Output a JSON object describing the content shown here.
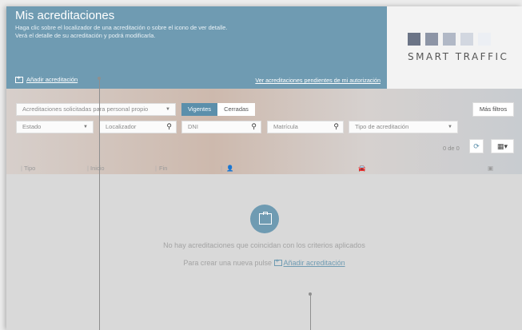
{
  "header": {
    "title": "Mis acreditaciones",
    "subtitle_line1": "Haga clic sobre el localizador de una acreditación o sobre el icono de ver detalle.",
    "subtitle_line2": "Verá el detalle de su acreditación y podrá modificarla.",
    "add_link": "Añadir acreditación",
    "pending_link": "Ver acreditaciones pendientes de mi autorización"
  },
  "logo": {
    "text": "SMART TRAFFIC",
    "square_colors": [
      "#6b7486",
      "#8d95a6",
      "#b1b8c6",
      "#d2d7e0",
      "#eceff4"
    ]
  },
  "filters": {
    "scope_select": "Acreditaciones solicitadas para personal propio",
    "segment": {
      "active": "Vigentes",
      "inactive": "Cerradas"
    },
    "more_filters": "Más filtros",
    "estado_placeholder": "Estado",
    "localizador_placeholder": "Localizador",
    "dni_placeholder": "DNI",
    "matricula_placeholder": "Matrícula",
    "tipo_placeholder": "Tipo de acreditación",
    "count": "0 de 0"
  },
  "columns": {
    "tipo": "Tipo",
    "inicio": "Inicio",
    "fin": "Fin"
  },
  "empty": {
    "message": "No hay acreditaciones que coincidan con los criterios aplicados",
    "hint_prefix": "Para crear una nueva pulse",
    "hint_link": "Añadir acreditación"
  },
  "colors": {
    "accent": "#6f9bb2",
    "segment_active": "#5b8fab"
  }
}
